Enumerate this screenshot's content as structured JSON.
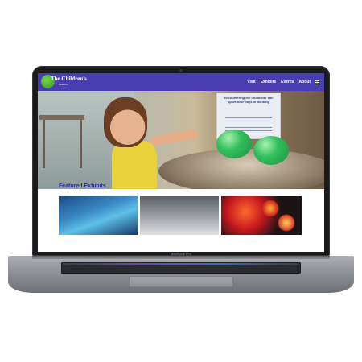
{
  "device": {
    "label": "MacBook Pro"
  },
  "site": {
    "logo": {
      "text": "The Children's",
      "subtext": "Museum"
    },
    "nav": {
      "items": [
        "Visit",
        "Exhibits",
        "Events",
        "About"
      ],
      "menu_icon": "hamburger-menu-icon"
    },
    "hero": {
      "sign_title": "Encountering the unfamiliar can spark new ways of thinking"
    },
    "featured": {
      "heading": "Featured Exhibits"
    },
    "colors": {
      "nav": "#4a3db0",
      "heading": "#2b2fa0"
    }
  }
}
